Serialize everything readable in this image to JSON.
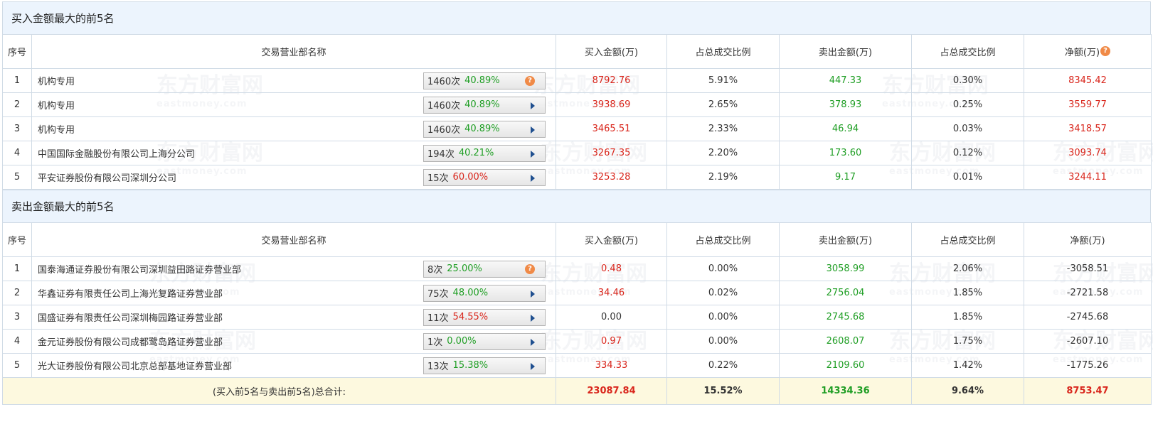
{
  "watermark": {
    "cn": "东方财富网",
    "en": "eastmoney.com"
  },
  "columns": {
    "seq": "序号",
    "name": "交易营业部名称",
    "buy": "买入金额(万)",
    "buy_pct": "占总成交比例",
    "sell": "卖出金额(万)",
    "sell_pct": "占总成交比例",
    "net": "净额(万)"
  },
  "buy_section": {
    "title": "买入金额最大的前5名",
    "rows": [
      {
        "seq": "1",
        "name": "机构专用",
        "count": "1460次",
        "rate": "40.89%",
        "rate_color": "green",
        "icon": "help-icon",
        "buy": "8792.76",
        "buy_pct": "5.91%",
        "sell": "447.33",
        "sell_pct": "0.30%",
        "net": "8345.42",
        "net_color": "red"
      },
      {
        "seq": "2",
        "name": "机构专用",
        "count": "1460次",
        "rate": "40.89%",
        "rate_color": "green",
        "icon": "arrow-icon",
        "buy": "3938.69",
        "buy_pct": "2.65%",
        "sell": "378.93",
        "sell_pct": "0.25%",
        "net": "3559.77",
        "net_color": "red"
      },
      {
        "seq": "3",
        "name": "机构专用",
        "count": "1460次",
        "rate": "40.89%",
        "rate_color": "green",
        "icon": "arrow-icon",
        "buy": "3465.51",
        "buy_pct": "2.33%",
        "sell": "46.94",
        "sell_pct": "0.03%",
        "net": "3418.57",
        "net_color": "red"
      },
      {
        "seq": "4",
        "name": "中国国际金融股份有限公司上海分公司",
        "count": "194次",
        "rate": "40.21%",
        "rate_color": "green",
        "icon": "arrow-icon",
        "buy": "3267.35",
        "buy_pct": "2.20%",
        "sell": "173.60",
        "sell_pct": "0.12%",
        "net": "3093.74",
        "net_color": "red"
      },
      {
        "seq": "5",
        "name": "平安证券股份有限公司深圳分公司",
        "count": "15次",
        "rate": "60.00%",
        "rate_color": "red",
        "icon": "arrow-icon",
        "buy": "3253.28",
        "buy_pct": "2.19%",
        "sell": "9.17",
        "sell_pct": "0.01%",
        "net": "3244.11",
        "net_color": "red"
      }
    ]
  },
  "sell_section": {
    "title": "卖出金额最大的前5名",
    "rows": [
      {
        "seq": "1",
        "name": "国泰海通证券股份有限公司深圳益田路证券营业部",
        "count": "8次",
        "rate": "25.00%",
        "rate_color": "green",
        "icon": "help-icon",
        "buy": "0.48",
        "buy_color": "red",
        "buy_pct": "0.00%",
        "sell": "3058.99",
        "sell_pct": "2.06%",
        "net": "-3058.51",
        "net_color": "dark"
      },
      {
        "seq": "2",
        "name": "华鑫证券有限责任公司上海光复路证券营业部",
        "count": "75次",
        "rate": "48.00%",
        "rate_color": "green",
        "icon": "arrow-icon",
        "buy": "34.46",
        "buy_color": "red",
        "buy_pct": "0.02%",
        "sell": "2756.04",
        "sell_pct": "1.85%",
        "net": "-2721.58",
        "net_color": "dark"
      },
      {
        "seq": "3",
        "name": "国盛证券有限责任公司深圳梅园路证券营业部",
        "count": "11次",
        "rate": "54.55%",
        "rate_color": "red",
        "icon": "arrow-icon",
        "buy": "0.00",
        "buy_color": "dark",
        "buy_pct": "0.00%",
        "sell": "2745.68",
        "sell_pct": "1.85%",
        "net": "-2745.68",
        "net_color": "dark"
      },
      {
        "seq": "4",
        "name": "金元证券股份有限公司成都鹭岛路证券营业部",
        "count": "1次",
        "rate": "0.00%",
        "rate_color": "green",
        "icon": "arrow-icon",
        "buy": "0.97",
        "buy_color": "red",
        "buy_pct": "0.00%",
        "sell": "2608.07",
        "sell_pct": "1.75%",
        "net": "-2607.10",
        "net_color": "dark"
      },
      {
        "seq": "5",
        "name": "光大证券股份有限公司北京总部基地证券营业部",
        "count": "13次",
        "rate": "15.38%",
        "rate_color": "green",
        "icon": "arrow-icon",
        "buy": "334.33",
        "buy_color": "red",
        "buy_pct": "0.22%",
        "sell": "2109.60",
        "sell_pct": "1.42%",
        "net": "-1775.26",
        "net_color": "dark"
      }
    ]
  },
  "total": {
    "label": "(买入前5名与卖出前5名)总合计:",
    "buy": "23087.84",
    "buy_pct": "15.52%",
    "sell": "14334.36",
    "sell_pct": "9.64%",
    "net": "8753.47"
  },
  "colors": {
    "red": "#d9261c",
    "green": "#1f9e24",
    "header_bg": "#ecf4fd",
    "total_bg": "#fdf9df",
    "border": "#d0dbe6"
  }
}
